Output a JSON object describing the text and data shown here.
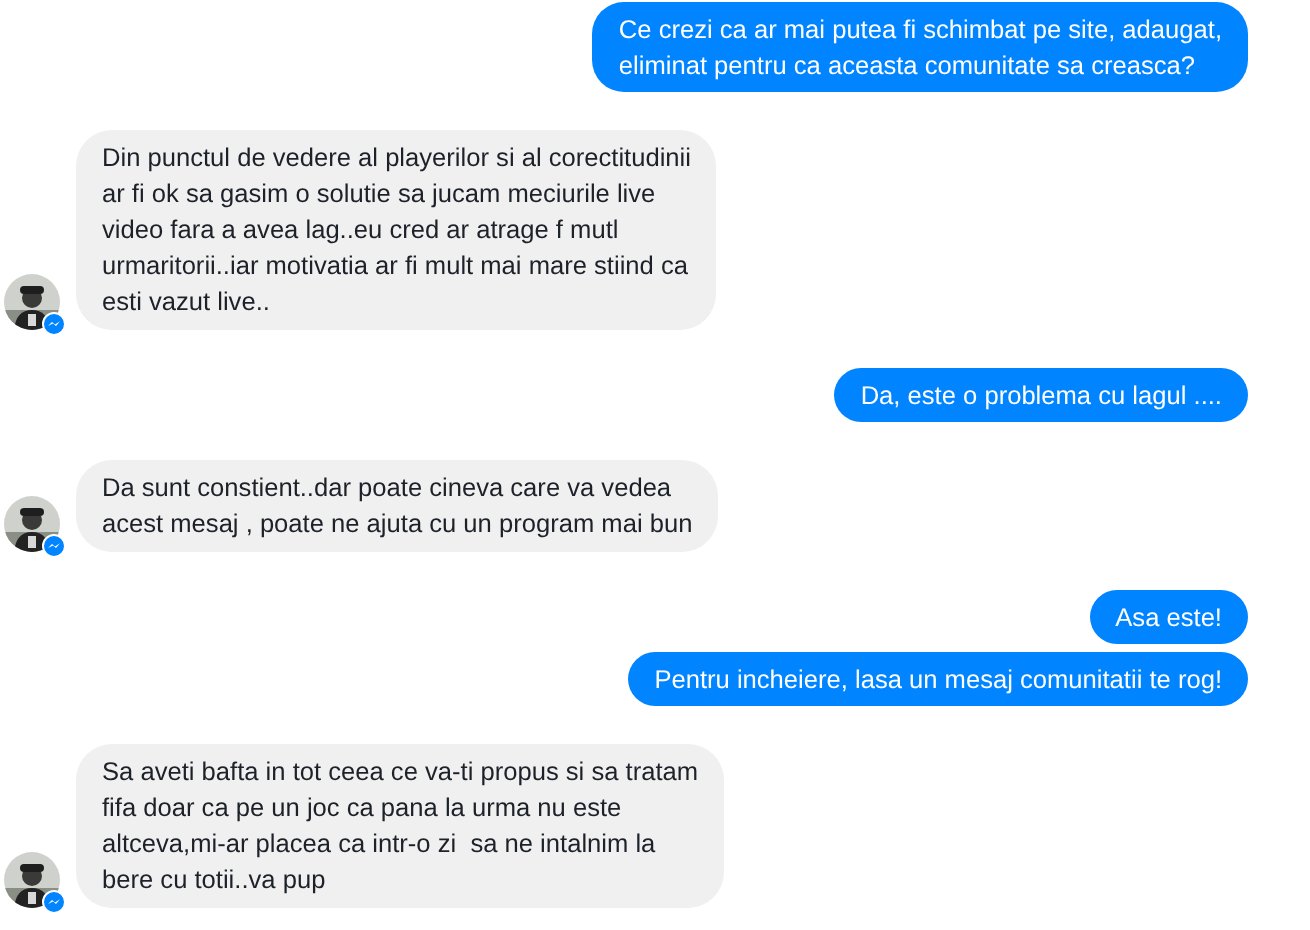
{
  "messages": [
    {
      "kind": "outgoing",
      "text": "Ce crezi ca ar mai putea fi schimbat pe site, adaugat,\neliminat pentru ca aceasta comunitate sa creasca?"
    },
    {
      "kind": "incoming",
      "text": "Din punctul de vedere al playerilor si al corectitudinii\nar fi ok sa gasim o solutie sa jucam meciurile live\nvideo fara a avea lag..eu cred ar atrage f mutl\nurmaritorii..iar motivatia ar fi mult mai mare stiind ca\nesti vazut live.."
    },
    {
      "kind": "outgoing",
      "text": "Da, este o problema cu lagul ...."
    },
    {
      "kind": "incoming",
      "text": "Da sunt constient..dar poate cineva care va vedea\nacest mesaj , poate ne ajuta cu un program mai bun"
    },
    {
      "kind": "outgoing",
      "text": "Asa este!"
    },
    {
      "kind": "outgoing",
      "text": "Pentru incheiere, lasa un mesaj comunitatii te rog!"
    },
    {
      "kind": "incoming",
      "text": "Sa aveti bafta in tot ceea ce va-ti propus si sa tratam\nfifa doar ca pe un joc ca pana la urma nu este\naltceva,mi-ar placea ca intr-o zi  sa ne intalnim la\nbere cu totii..va pup"
    }
  ]
}
